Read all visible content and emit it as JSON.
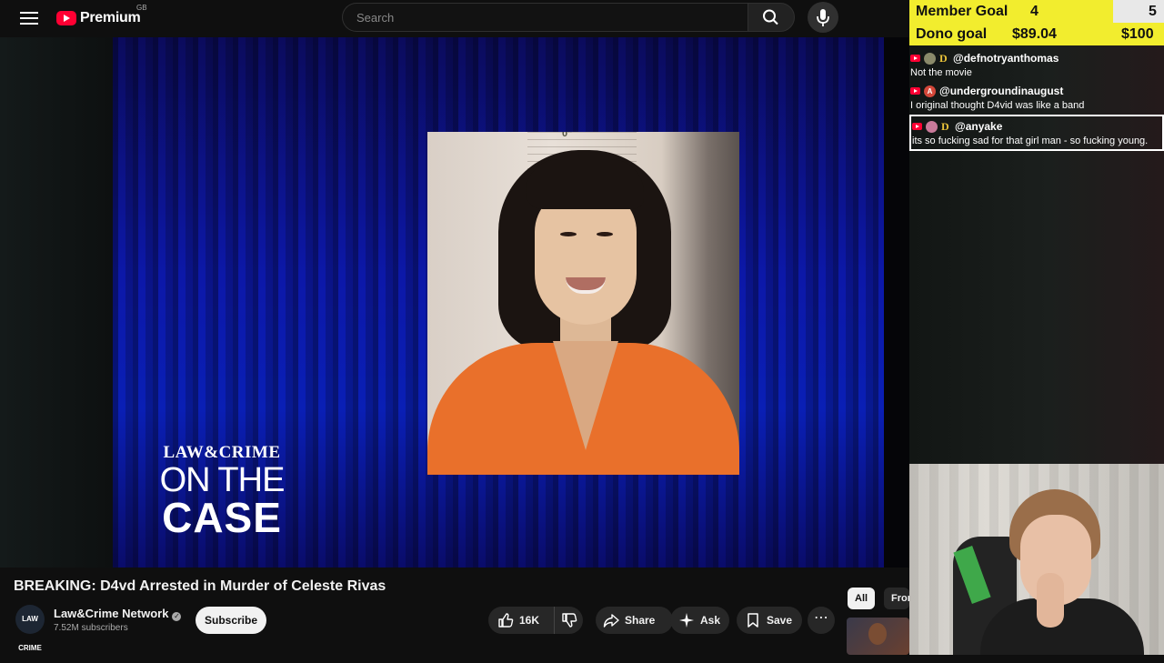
{
  "header": {
    "logo_text": "Premium",
    "logo_region": "GB",
    "search_placeholder": "Search"
  },
  "video": {
    "brand_top": "LAW&CRIME",
    "brand_mid": "ON THE",
    "brand_bottom": "CASE",
    "mugshot_ruler_label": "0\"",
    "title": "BREAKING: D4vd Arrested in Murder of Celeste Rivas"
  },
  "channel": {
    "avatar_text": "LAW CRIME",
    "name": "Law&Crime Network",
    "subscribers": "7.52M subscribers",
    "subscribe_label": "Subscribe"
  },
  "actions": {
    "like_count": "16K",
    "share_label": "Share",
    "ask_label": "Ask",
    "save_label": "Save",
    "more_label": "⋯"
  },
  "recommendations": {
    "chips": [
      "All",
      "From"
    ]
  },
  "overlay": {
    "member_goal_label": "Member Goal",
    "member_goal_current": "4",
    "member_goal_target": "5",
    "dono_goal_label": "Dono goal",
    "dono_goal_current": "$89.04",
    "dono_goal_target": "$100"
  },
  "chat": {
    "messages": [
      {
        "user": "@defnotryanthomas",
        "text": "Not the movie",
        "badge": "avatar"
      },
      {
        "user": "@undergroundinaugust",
        "text": "I original thought D4vid was like a band",
        "badge": "A"
      },
      {
        "user": "@anyake",
        "text": "its so fucking sad for that girl man - so fucking young.",
        "badge": "avatar"
      }
    ]
  },
  "colors": {
    "brand_red": "#ff0033",
    "goal_yellow": "#f2ed2e",
    "video_blue": "#0c18a8",
    "prison_orange": "#e9702b"
  }
}
